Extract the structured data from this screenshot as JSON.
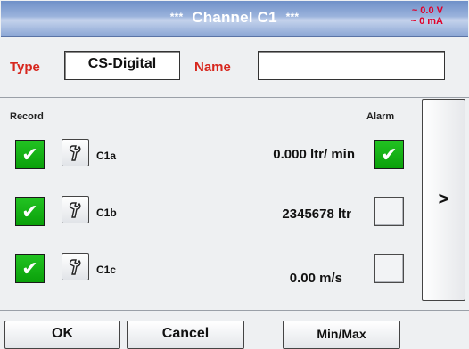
{
  "header": {
    "title_prefix": "***",
    "title": "Channel C1",
    "title_suffix": "***",
    "voltage": "~ 0.0 V",
    "current": "~ 0 mA"
  },
  "form": {
    "type_label": "Type",
    "type_value": "CS-Digital",
    "name_label": "Name",
    "name_value": ""
  },
  "columns": {
    "record": "Record",
    "alarm": "Alarm"
  },
  "rows": [
    {
      "label": "C1a",
      "value": "0.000 ltr/ min",
      "record": true,
      "alarm": true
    },
    {
      "label": "C1b",
      "value": "2345678 ltr",
      "record": true,
      "alarm": false
    },
    {
      "label": "C1c",
      "value": "0.00 m/s",
      "record": true,
      "alarm": false
    }
  ],
  "nav": {
    "next_label": ">"
  },
  "buttons": {
    "ok": "OK",
    "cancel": "Cancel",
    "minmax": "Min/Max"
  },
  "icons": {
    "check": "check-icon",
    "tool": "wrench-icon"
  },
  "colors": {
    "accent_red": "#d7271e",
    "check_green": "#14b014",
    "title_blue": "#7f9ccf"
  }
}
